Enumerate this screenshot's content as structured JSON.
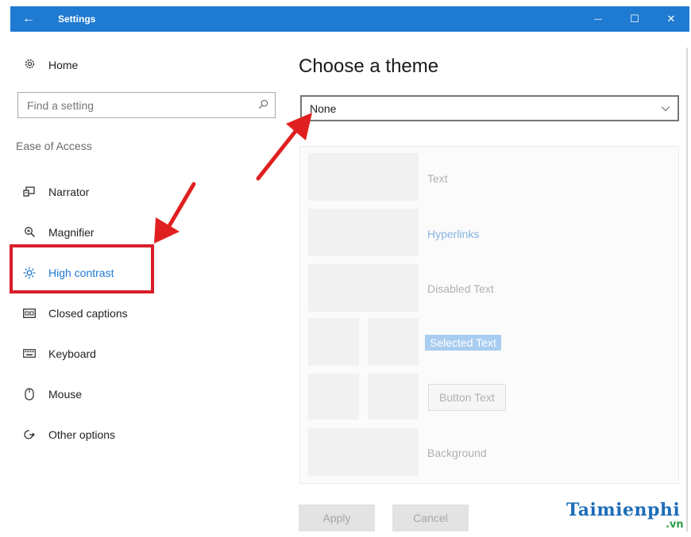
{
  "window": {
    "title": "Settings",
    "back_glyph": "←",
    "minimize_glyph": "—",
    "maximize_glyph": "☐",
    "close_glyph": "✕",
    "accent_color": "#1f7ad1"
  },
  "sidebar": {
    "home_label": "Home",
    "home_icon": "gear-icon",
    "search_placeholder": "Find a setting",
    "search_icon": "search-icon",
    "section_label": "Ease of Access",
    "items": [
      {
        "label": "Narrator",
        "icon": "narrator-icon"
      },
      {
        "label": "Magnifier",
        "icon": "magnifier-icon"
      },
      {
        "label": "High contrast",
        "icon": "brightness-icon",
        "active": true
      },
      {
        "label": "Closed captions",
        "icon": "closed-captions-icon"
      },
      {
        "label": "Keyboard",
        "icon": "keyboard-icon"
      },
      {
        "label": "Mouse",
        "icon": "mouse-icon"
      },
      {
        "label": "Other options",
        "icon": "other-options-icon"
      }
    ]
  },
  "main": {
    "heading": "Choose a theme",
    "theme_select": {
      "value": "None"
    },
    "preview": {
      "text": "Text",
      "hyperlinks": "Hyperlinks",
      "disabled_text": "Disabled Text",
      "selected_text": "Selected Text",
      "button_text": "Button Text",
      "background": "Background"
    },
    "apply_label": "Apply",
    "cancel_label": "Cancel"
  },
  "annotation": {
    "highlight_color": "#d91e2a"
  },
  "watermark": {
    "brand": "Taimienphi",
    "suffix": ".vn"
  }
}
